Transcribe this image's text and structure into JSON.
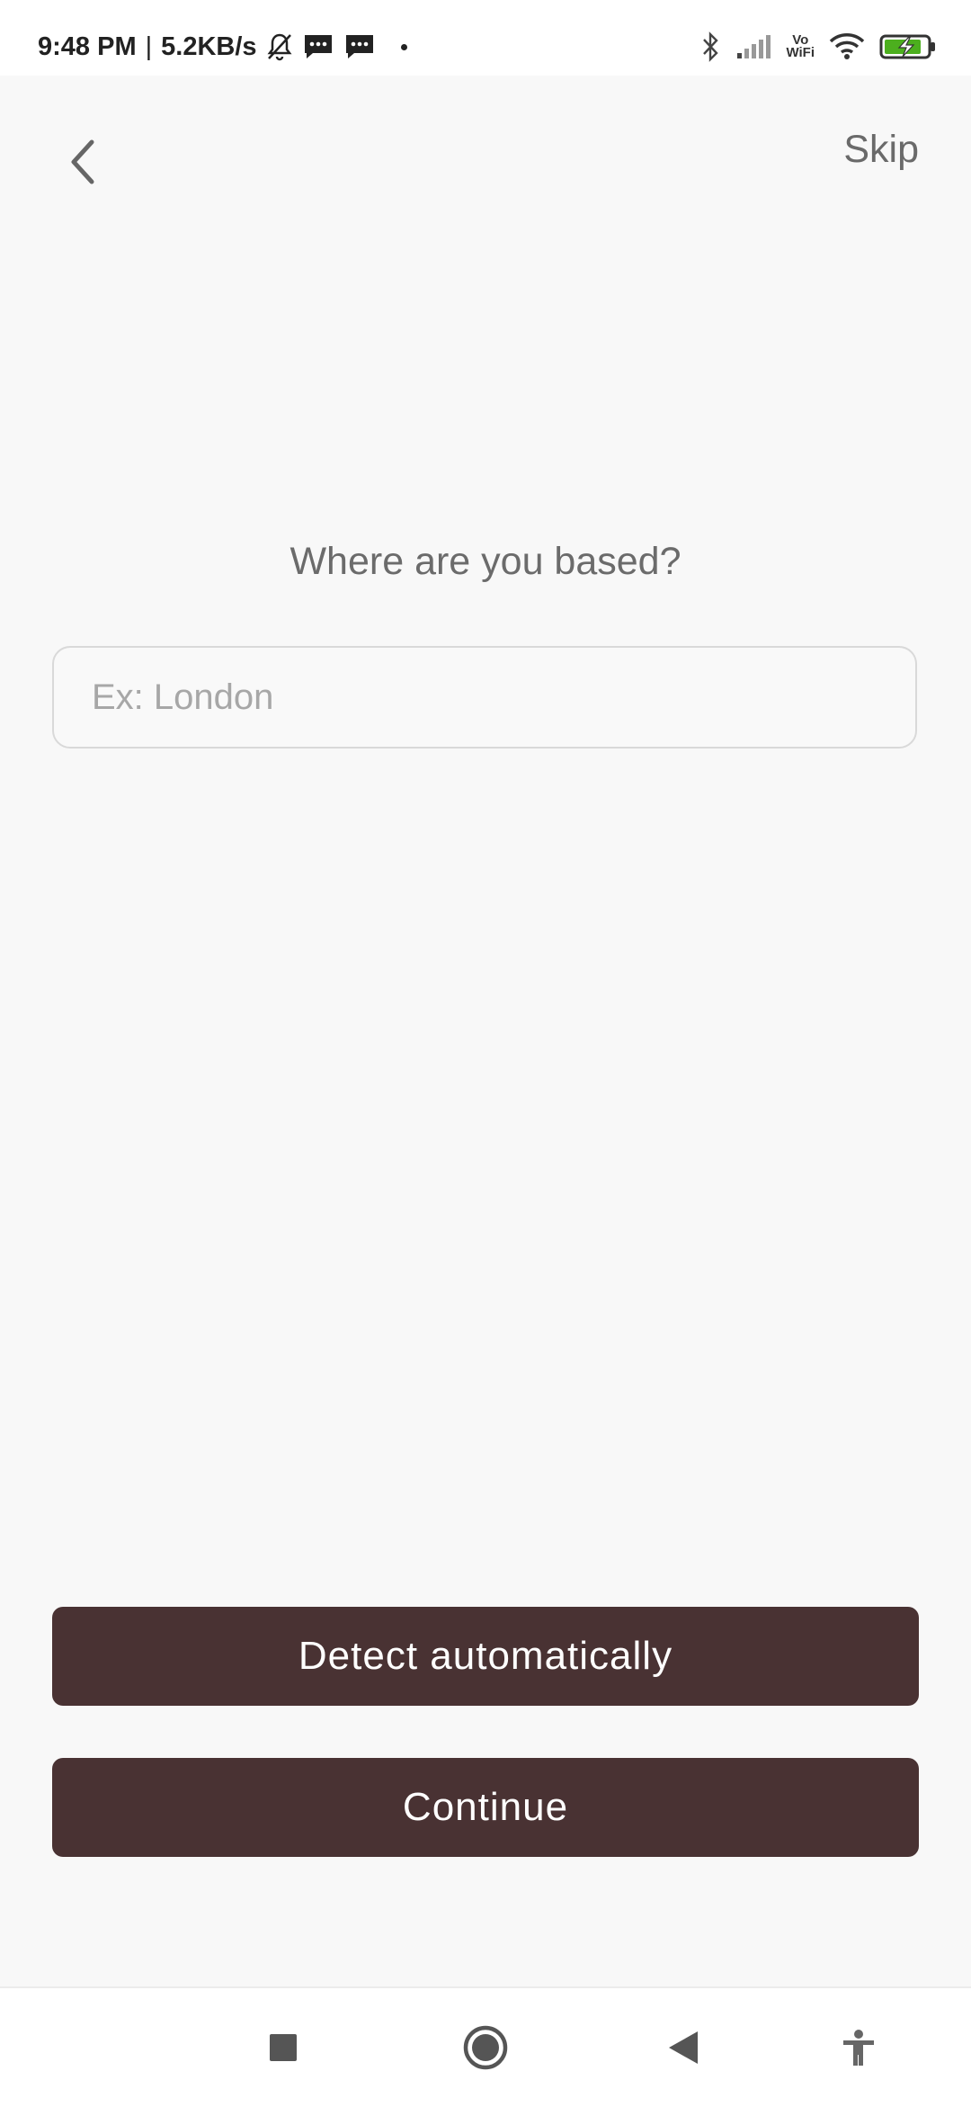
{
  "status_bar": {
    "time": "9:48 PM",
    "separator": "|",
    "speed": "5.2KB/s",
    "vowifi_top": "Vo",
    "vowifi_bottom": "WiFi",
    "icons": [
      "mute-bell-icon",
      "message-icon",
      "message-icon",
      "bluetooth-icon",
      "signal-icon",
      "wifi-icon",
      "battery-charging-icon"
    ]
  },
  "header": {
    "back_icon": "chevron-left-icon",
    "skip_label": "Skip"
  },
  "main": {
    "question": "Where are you based?",
    "location_input": {
      "placeholder": "Ex: London",
      "value": ""
    }
  },
  "actions": {
    "detect_label": "Detect automatically",
    "continue_label": "Continue"
  },
  "nav_bar": {
    "icons": [
      "recents-square-icon",
      "home-circle-icon",
      "back-triangle-icon",
      "accessibility-icon"
    ]
  },
  "colors": {
    "background": "#f8f8f8",
    "button": "#493233",
    "button_text": "#ffffff",
    "text_muted": "#6b6b6b",
    "battery_green": "#4caf1e"
  }
}
